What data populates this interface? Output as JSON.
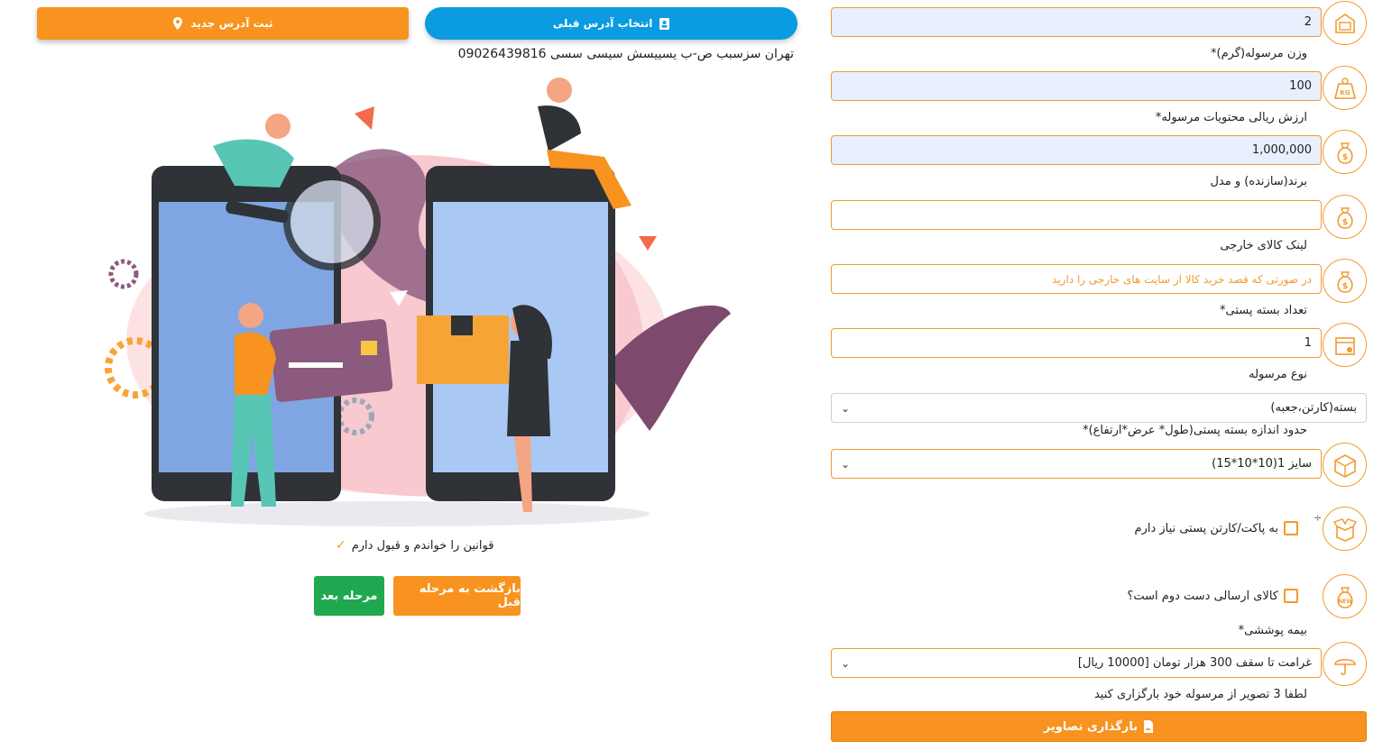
{
  "header": {
    "new_address_label": "ثبت آدرس جدید",
    "select_address_label": "انتخاب آدرس قبلی"
  },
  "address": {
    "text": "تهران سزسبب ص-ب یسییسش سیسی سسی 09026439816"
  },
  "form": {
    "quantity_value": "2",
    "weight_label": "وزن مرسوله(گرم)*",
    "weight_value": "100",
    "value_label": "ارزش ریالی محتویات مرسوله*",
    "value_value": "1,000,000",
    "brand_label": "برند(سازنده) و مدل",
    "brand_value": "",
    "link_label": "لینک کالای خارجی",
    "link_placeholder": "در صورتی که قصد خرید کالا از سایت های خارجی را دارید",
    "packages_label": "تعداد بسته پستی*",
    "packages_value": "1",
    "type_label": "نوع مرسوله",
    "type_selected": "بسته(کارتن،جعبه)",
    "size_label": "حدود اندازه بسته پستی(طول* عرض*ارتفاع)*",
    "size_selected": "سایز 1(10*10*15)",
    "need_box_label": "به پاکت/کارتن پستی نیاز دارم",
    "second_hand_label": "کالای ارسالی دست دوم است؟",
    "insurance_label": "بیمه پوششی*",
    "insurance_selected": "غرامت تا سقف 300 هزار تومان [10000 ریال]",
    "upload_hint": "لطفا 3 تصویر از مرسوله خود بارگزاری کنید",
    "upload_button": "بارگذاری تصاویر",
    "plus_mark": "÷"
  },
  "footer": {
    "terms_label": "قوانین را خواندم و قبول دارم",
    "back_button": "بازگشت به مرحله قبل",
    "next_button": "مرحله بعد"
  },
  "icons": {
    "quantity": "box-icon",
    "weight": "weight-kg-icon",
    "value": "money-bag-icon",
    "brand": "money-bag-icon",
    "link": "money-bag-icon",
    "packages": "package-icon",
    "size": "box-dimensions-icon",
    "need_box": "open-box-icon",
    "second_hand": "new-bag-icon",
    "insurance": "umbrella-icon"
  },
  "colors": {
    "accent": "#f7931e",
    "blue": "#0a9be0",
    "green": "#1fa84f",
    "field_fill": "#e8f0fe"
  }
}
